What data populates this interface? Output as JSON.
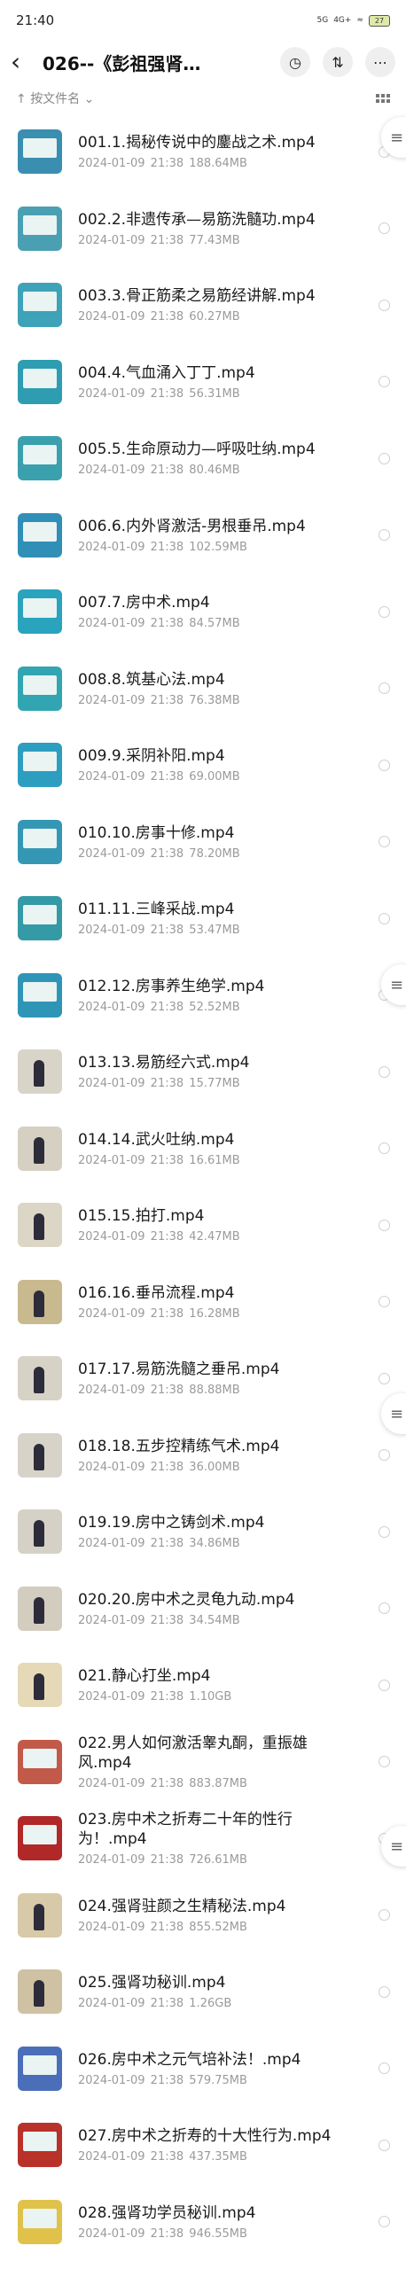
{
  "status": {
    "time": "21:40",
    "signal1": "5G",
    "signal2": "4G+",
    "battery": "27"
  },
  "header": {
    "title": "026--《彭祖强肾…"
  },
  "sort": {
    "label": "按文件名"
  },
  "files": [
    {
      "name": "001.1.揭秘传说中的鏖战之术.mp4",
      "date": "2024-01-09  21:38",
      "size": "188.64MB",
      "thumb": "#3a8fb0"
    },
    {
      "name": "002.2.非遗传承—易筋洗髓功.mp4",
      "date": "2024-01-09  21:38",
      "size": "77.43MB",
      "thumb": "#4b9fb3"
    },
    {
      "name": "003.3.骨正筋柔之易筋经讲解.mp4",
      "date": "2024-01-09  21:38",
      "size": "60.27MB",
      "thumb": "#3ea2b8"
    },
    {
      "name": "004.4.气血涌入丁丁.mp4",
      "date": "2024-01-09  21:38",
      "size": "56.31MB",
      "thumb": "#2f9db1"
    },
    {
      "name": "005.5.生命原动力—呼吸吐纳.mp4",
      "date": "2024-01-09  21:38",
      "size": "80.46MB",
      "thumb": "#3aa0ad"
    },
    {
      "name": "006.6.内外肾激活-男根垂吊.mp4",
      "date": "2024-01-09  21:38",
      "size": "102.59MB",
      "thumb": "#2f8fb6"
    },
    {
      "name": "007.7.房中术.mp4",
      "date": "2024-01-09  21:38",
      "size": "84.57MB",
      "thumb": "#2aa3bd"
    },
    {
      "name": "008.8.筑基心法.mp4",
      "date": "2024-01-09  21:38",
      "size": "76.38MB",
      "thumb": "#31a6b2"
    },
    {
      "name": "009.9.采阴补阳.mp4",
      "date": "2024-01-09  21:38",
      "size": "69.00MB",
      "thumb": "#2e9ec0"
    },
    {
      "name": "010.10.房事十修.mp4",
      "date": "2024-01-09  21:38",
      "size": "78.20MB",
      "thumb": "#3498b4"
    },
    {
      "name": "011.11.三峰采战.mp4",
      "date": "2024-01-09  21:38",
      "size": "53.47MB",
      "thumb": "#349aa6"
    },
    {
      "name": "012.12.房事养生绝学.mp4",
      "date": "2024-01-09  21:38",
      "size": "52.52MB",
      "thumb": "#2f95b7"
    },
    {
      "name": "013.13.易筋经六式.mp4",
      "date": "2024-01-09  21:38",
      "size": "15.77MB",
      "thumb": "#d9d4c8"
    },
    {
      "name": "014.14.武火吐纳.mp4",
      "date": "2024-01-09  21:38",
      "size": "16.61MB",
      "thumb": "#d6d0c2"
    },
    {
      "name": "015.15.拍打.mp4",
      "date": "2024-01-09  21:38",
      "size": "42.47MB",
      "thumb": "#dcd6c6"
    },
    {
      "name": "016.16.垂吊流程.mp4",
      "date": "2024-01-09  21:38",
      "size": "16.28MB",
      "thumb": "#c9b98f"
    },
    {
      "name": "017.17.易筋洗髓之垂吊.mp4",
      "date": "2024-01-09  21:38",
      "size": "88.88MB",
      "thumb": "#d7d2c6"
    },
    {
      "name": "018.18.五步控精练气术.mp4",
      "date": "2024-01-09  21:38",
      "size": "36.00MB",
      "thumb": "#d8d3c9"
    },
    {
      "name": "019.19.房中之铸剑术.mp4",
      "date": "2024-01-09  21:38",
      "size": "34.86MB",
      "thumb": "#d5d1c6"
    },
    {
      "name": "020.20.房中术之灵龟九动.mp4",
      "date": "2024-01-09  21:38",
      "size": "34.54MB",
      "thumb": "#d2cdbf"
    },
    {
      "name": "021.静心打坐.mp4",
      "date": "2024-01-09  21:38",
      "size": "1.10GB",
      "thumb": "#e6d9b8"
    },
    {
      "name": "022.男人如何激活睾丸酮，重振雄风.mp4",
      "date": "2024-01-09  21:38",
      "size": "883.87MB",
      "thumb": "#c25a4a"
    },
    {
      "name": "023.房中术之折寿二十年的性行为！.mp4",
      "date": "2024-01-09  21:38",
      "size": "726.61MB",
      "thumb": "#b02828"
    },
    {
      "name": "024.强肾驻颜之生精秘法.mp4",
      "date": "2024-01-09  21:38",
      "size": "855.52MB",
      "thumb": "#d8c9a8"
    },
    {
      "name": "025.强肾功秘训.mp4",
      "date": "2024-01-09  21:38",
      "size": "1.26GB",
      "thumb": "#cfc2a3"
    },
    {
      "name": "026.房中术之元气培补法！.mp4",
      "date": "2024-01-09  21:38",
      "size": "579.75MB",
      "thumb": "#4a6fb8"
    },
    {
      "name": "027.房中术之折寿的十大性行为.mp4",
      "date": "2024-01-09  21:38",
      "size": "437.35MB",
      "thumb": "#b8322a"
    },
    {
      "name": "028.强肾功学员秘训.mp4",
      "date": "2024-01-09  21:38",
      "size": "946.55MB",
      "thumb": "#e0c24a"
    }
  ]
}
